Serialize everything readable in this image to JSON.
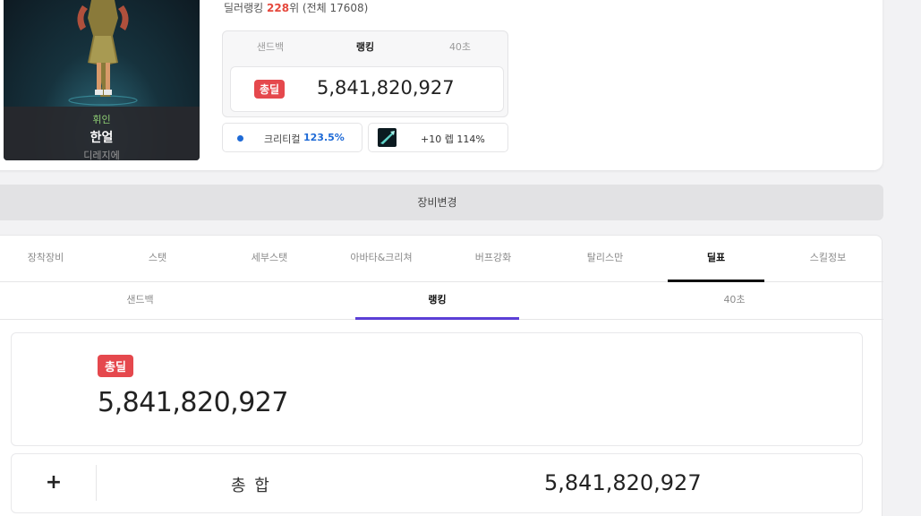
{
  "character": {
    "job": "휘인",
    "name": "한얼",
    "server": "디레지에"
  },
  "dealer_rank": {
    "label": "딜러랭킹",
    "rank": "228",
    "suffix": "위 (전체 17608)"
  },
  "mini_panel": {
    "tabs": [
      "샌드백",
      "랭킹",
      "40초"
    ],
    "active_tab": "랭킹",
    "total_badge": "총딜",
    "total_value": "5,841,820,927"
  },
  "crit_chip": {
    "label": "크리티컬",
    "value": "123.5%"
  },
  "weapon_chip": {
    "text": "+10 렙 114%",
    "icon": "weapon-icon"
  },
  "equip_button": {
    "label": "장비변경"
  },
  "main_tabs": [
    "장착장비",
    "스탯",
    "세부스탯",
    "아바타&크리쳐",
    "버프강화",
    "탈리스만",
    "딜표",
    "스킬정보"
  ],
  "active_main_tab": "딜표",
  "sub_tabs": [
    "샌드백",
    "랭킹",
    "40초"
  ],
  "active_sub_tab": "랭킹",
  "total_panel": {
    "badge": "총딜",
    "value": "5,841,820,927"
  },
  "sum_row": {
    "expand": "+",
    "label": "총 합",
    "value": "5,841,820,927"
  },
  "colors": {
    "badge_red": "#e5484d",
    "accent_purple": "#5b3fd6",
    "crit_blue": "#1e6ad6",
    "rank_red": "#e5483d"
  }
}
